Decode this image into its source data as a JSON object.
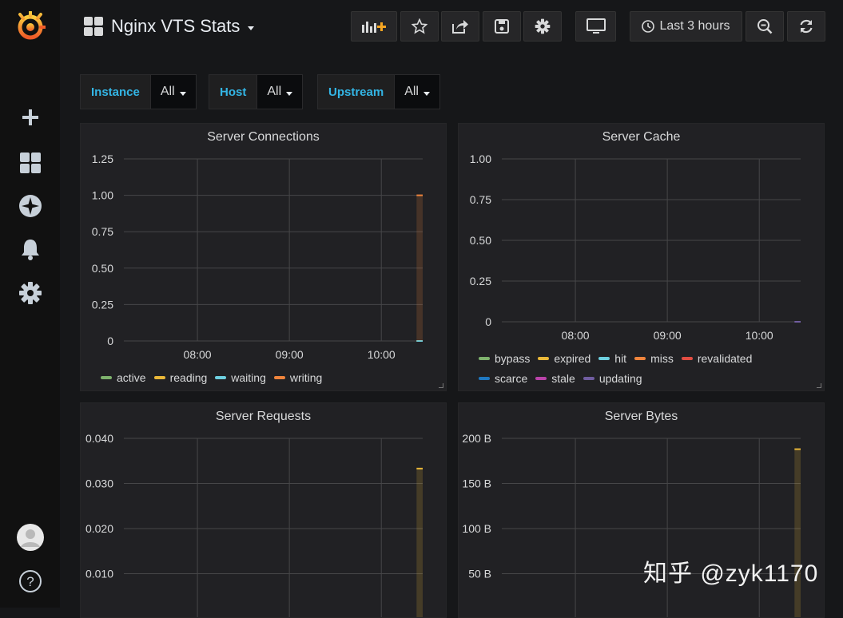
{
  "sidebar": {
    "items": [
      {
        "name": "grafana-logo",
        "icon": "grafana-logo-icon"
      },
      {
        "name": "create",
        "icon": "plus-icon"
      },
      {
        "name": "dashboards",
        "icon": "dashboards-icon"
      },
      {
        "name": "explore",
        "icon": "compass-icon"
      },
      {
        "name": "alerting",
        "icon": "bell-icon"
      },
      {
        "name": "configuration",
        "icon": "gear-icon"
      },
      {
        "name": "profile",
        "icon": "avatar-icon"
      },
      {
        "name": "help",
        "icon": "help-icon"
      }
    ]
  },
  "header": {
    "title": "Nginx VTS Stats",
    "time_range": "Last 3 hours",
    "buttons": [
      "add-panel-icon",
      "star-icon",
      "share-icon",
      "save-icon",
      "gear-icon",
      "tv-icon",
      "clock-icon",
      "zoom-out-icon",
      "refresh-icon"
    ]
  },
  "variables": [
    {
      "label": "Instance",
      "value": "All"
    },
    {
      "label": "Host",
      "value": "All"
    },
    {
      "label": "Upstream",
      "value": "All"
    }
  ],
  "colors": {
    "active": "#7eb26d",
    "reading": "#eab839",
    "waiting": "#6ed0e0",
    "writing": "#ef843c",
    "revalidated": "#e24d42",
    "scarce": "#1f78c1",
    "stale": "#ba43a9",
    "updating": "#705da0",
    "label_blue": "#33b5e5"
  },
  "panels": [
    {
      "title": "Server Connections",
      "legend": [
        {
          "name": "active",
          "color": "#7eb26d"
        },
        {
          "name": "reading",
          "color": "#eab839"
        },
        {
          "name": "waiting",
          "color": "#6ed0e0"
        },
        {
          "name": "writing",
          "color": "#ef843c"
        }
      ]
    },
    {
      "title": "Server Cache",
      "legend": [
        {
          "name": "bypass",
          "color": "#7eb26d"
        },
        {
          "name": "expired",
          "color": "#eab839"
        },
        {
          "name": "hit",
          "color": "#6ed0e0"
        },
        {
          "name": "miss",
          "color": "#ef843c"
        },
        {
          "name": "revalidated",
          "color": "#e24d42"
        },
        {
          "name": "scarce",
          "color": "#1f78c1"
        },
        {
          "name": "stale",
          "color": "#ba43a9"
        },
        {
          "name": "updating",
          "color": "#705da0"
        }
      ]
    },
    {
      "title": "Server Requests",
      "legend": []
    },
    {
      "title": "Server Bytes",
      "legend": []
    }
  ],
  "chart_data": [
    {
      "type": "line",
      "title": "Server Connections",
      "y_ticks": [
        "0",
        "0.25",
        "0.50",
        "0.75",
        "1.00",
        "1.25"
      ],
      "ylim": [
        0,
        1.25
      ],
      "x_ticks": [
        "08:00",
        "09:00",
        "10:00"
      ],
      "xlim": [
        "07:12",
        "10:27"
      ],
      "grid": true,
      "legend_position": "bottom",
      "series": [
        {
          "name": "active",
          "color": "#7eb26d",
          "points": [
            [
              "10:23",
              0
            ],
            [
              "10:27",
              0
            ]
          ]
        },
        {
          "name": "reading",
          "color": "#eab839",
          "points": [
            [
              "10:23",
              0
            ],
            [
              "10:27",
              0
            ]
          ]
        },
        {
          "name": "waiting",
          "color": "#6ed0e0",
          "points": [
            [
              "10:23",
              0
            ],
            [
              "10:27",
              0
            ]
          ]
        },
        {
          "name": "writing",
          "color": "#ef843c",
          "points": [
            [
              "10:23",
              1.0
            ],
            [
              "10:27",
              1.0
            ]
          ]
        }
      ]
    },
    {
      "type": "line",
      "title": "Server Cache",
      "y_ticks": [
        "0",
        "0.25",
        "0.50",
        "0.75",
        "1.00"
      ],
      "ylim": [
        0,
        1.0
      ],
      "x_ticks": [
        "08:00",
        "09:00",
        "10:00"
      ],
      "xlim": [
        "07:12",
        "10:27"
      ],
      "grid": true,
      "legend_position": "bottom",
      "series": [
        {
          "name": "updating",
          "color": "#705da0",
          "points": [
            [
              "10:23",
              0
            ],
            [
              "10:27",
              0
            ]
          ]
        }
      ]
    },
    {
      "type": "line",
      "title": "Server Requests",
      "y_ticks": [
        "0.010",
        "0.020",
        "0.030",
        "0.040"
      ],
      "ylim": [
        0,
        0.04
      ],
      "x_ticks": [
        "08:00",
        "09:00",
        "10:00"
      ],
      "xlim": [
        "07:12",
        "10:27"
      ],
      "grid": true,
      "series": [
        {
          "name": "",
          "color": "#eab839",
          "points": [
            [
              "10:23",
              0.0333
            ],
            [
              "10:27",
              0.0333
            ]
          ]
        }
      ]
    },
    {
      "type": "line",
      "title": "Server Bytes",
      "y_ticks": [
        "50 B",
        "100 B",
        "150 B",
        "200 B"
      ],
      "ylim": [
        0,
        200
      ],
      "x_ticks": [
        "08:00",
        "09:00",
        "10:00"
      ],
      "xlim": [
        "07:12",
        "10:27"
      ],
      "grid": true,
      "series": [
        {
          "name": "",
          "color": "#eab839",
          "points": [
            [
              "10:23",
              188
            ],
            [
              "10:27",
              188
            ]
          ]
        }
      ]
    }
  ],
  "watermark": "知乎 @zyk1170"
}
